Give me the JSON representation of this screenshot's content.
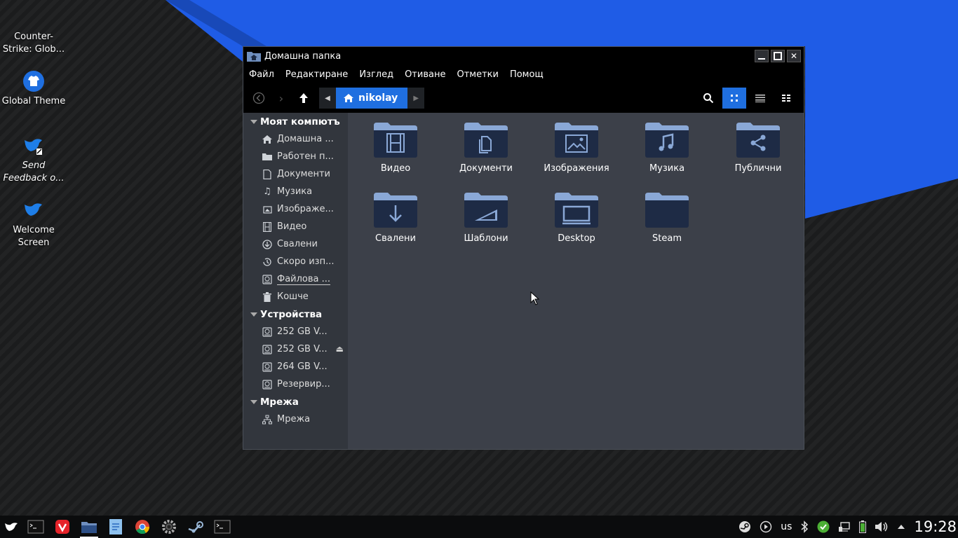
{
  "desktop": {
    "icons": [
      {
        "label": "Counter-Strike: Glob..."
      },
      {
        "label": "Global Theme"
      },
      {
        "label": "Send Feedback o..."
      },
      {
        "label": "Welcome Screen"
      }
    ],
    "accent_blue": "#1f6fe0"
  },
  "window": {
    "title": "Домашна папка",
    "menu": [
      "Файл",
      "Редактиране",
      "Изглед",
      "Отиване",
      "Отметки",
      "Помощ"
    ],
    "path": {
      "current": "nikolay"
    },
    "sidebar": {
      "sections": [
        {
          "title": "Моят компютъ",
          "items": [
            {
              "label": "Домашна ...",
              "icon": "home-icon"
            },
            {
              "label": "Работен п...",
              "icon": "folder-icon"
            },
            {
              "label": "Документи",
              "icon": "document-icon"
            },
            {
              "label": "Музика",
              "icon": "music-icon"
            },
            {
              "label": "Изображе...",
              "icon": "image-icon"
            },
            {
              "label": "Видео",
              "icon": "video-icon"
            },
            {
              "label": "Свалени",
              "icon": "download-icon"
            },
            {
              "label": "Скоро изп...",
              "icon": "history-icon"
            },
            {
              "label": "Файлова ...",
              "icon": "drive-icon"
            },
            {
              "label": "Кошче",
              "icon": "trash-icon"
            }
          ]
        },
        {
          "title": "Устройства",
          "items": [
            {
              "label": "252 GB V...",
              "icon": "drive-icon"
            },
            {
              "label": "252 GB V...",
              "icon": "drive-icon"
            },
            {
              "label": "264 GB V...",
              "icon": "drive-icon"
            },
            {
              "label": "Резервир...",
              "icon": "drive-icon"
            }
          ]
        },
        {
          "title": "Мрежа",
          "items": [
            {
              "label": "Мрежа",
              "icon": "network-icon"
            }
          ]
        }
      ]
    },
    "folders": [
      {
        "label": "Видео",
        "icon": "video-icon"
      },
      {
        "label": "Документи",
        "icon": "document-icon"
      },
      {
        "label": "Изображения",
        "icon": "image-icon"
      },
      {
        "label": "Музика",
        "icon": "music-icon"
      },
      {
        "label": "Публични",
        "icon": "share-icon"
      },
      {
        "label": "Свалени",
        "icon": "download-icon"
      },
      {
        "label": "Шаблони",
        "icon": "template-icon"
      },
      {
        "label": "Desktop",
        "icon": "desktop-icon"
      },
      {
        "label": "Steam",
        "icon": "folder-icon"
      }
    ]
  },
  "taskbar": {
    "keyboard_layout": "us",
    "clock": "19:28"
  }
}
